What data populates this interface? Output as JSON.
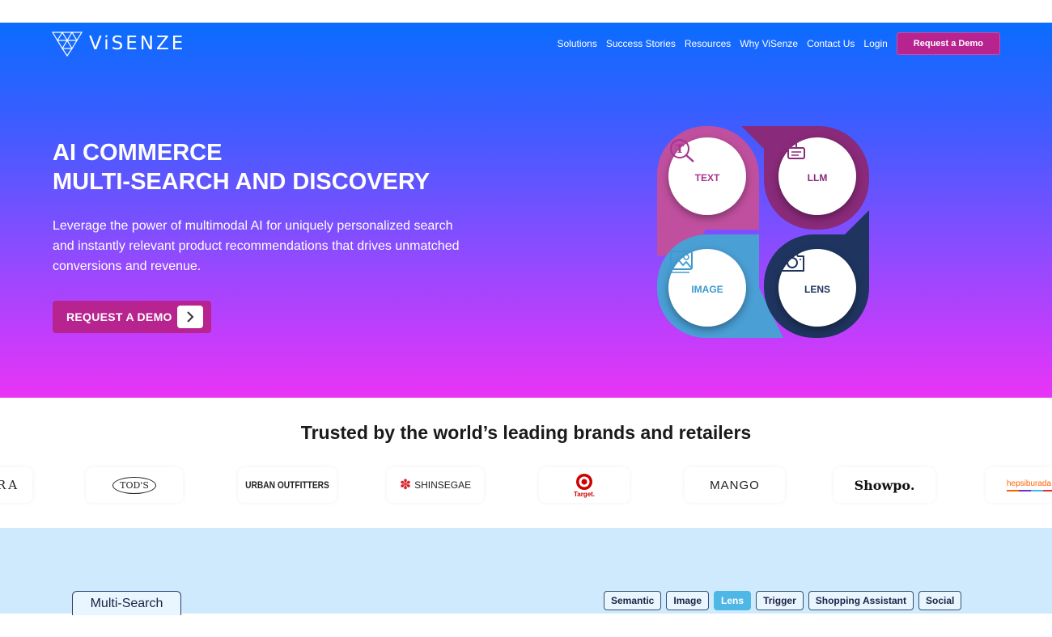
{
  "header": {
    "logo_text": "ViSENZE",
    "nav": [
      "Solutions",
      "Success Stories",
      "Resources",
      "Why ViSenze",
      "Contact Us",
      "Login"
    ],
    "cta_label": "Request a Demo"
  },
  "hero": {
    "title_line1": "AI COMMERCE",
    "title_line2": "MULTI-SEARCH AND DISCOVERY",
    "description": "Leverage the power of multimodal AI for uniquely personalized search and instantly relevant product recommendations that drives unmatched conversions and revenue.",
    "button_label": "REQUEST A DEMO"
  },
  "features": [
    {
      "label": "TEXT",
      "icon": "text-search-icon",
      "color": "#a8348f"
    },
    {
      "label": "LLM",
      "icon": "ai-chat-icon",
      "color": "#8a2a7a"
    },
    {
      "label": "IMAGE",
      "icon": "image-icon",
      "color": "#3d9ad0"
    },
    {
      "label": "LENS",
      "icon": "camera-icon",
      "color": "#1f3560"
    }
  ],
  "brands": {
    "title": "Trusted by the world’s leading brands and retailers",
    "logos": [
      "RA",
      "TOD'S",
      "URBAN OUTFITTERS",
      "SHINSEGAE",
      "Target.",
      "MANGO",
      "Showpo.",
      "hepsiburada"
    ]
  },
  "tabs": {
    "main_tab": "Multi-Search",
    "pills": [
      "Semantic",
      "Image",
      "Lens",
      "Trigger",
      "Shopping Assistant",
      "Social"
    ],
    "active_pill": "Lens"
  },
  "colors": {
    "accent": "#b8248f",
    "gradient_top": "#0a6cff",
    "gradient_bottom": "#ea34f6"
  }
}
